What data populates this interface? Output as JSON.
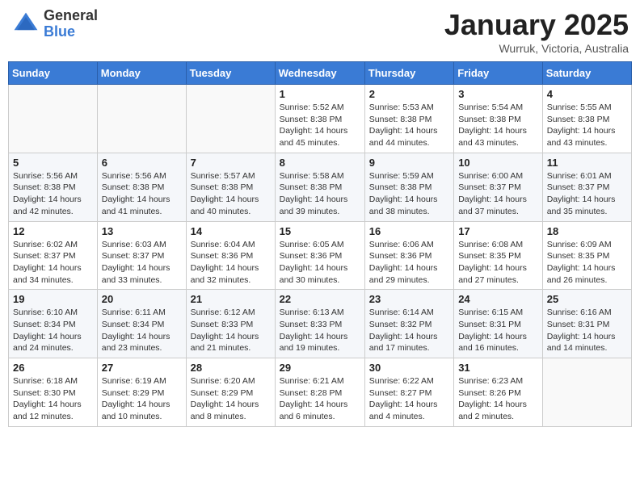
{
  "header": {
    "logo": {
      "general": "General",
      "blue": "Blue"
    },
    "title": "January 2025",
    "location": "Wurruk, Victoria, Australia"
  },
  "calendar": {
    "days_of_week": [
      "Sunday",
      "Monday",
      "Tuesday",
      "Wednesday",
      "Thursday",
      "Friday",
      "Saturday"
    ],
    "weeks": [
      [
        {
          "day": "",
          "info": ""
        },
        {
          "day": "",
          "info": ""
        },
        {
          "day": "",
          "info": ""
        },
        {
          "day": "1",
          "info": "Sunrise: 5:52 AM\nSunset: 8:38 PM\nDaylight: 14 hours\nand 45 minutes."
        },
        {
          "day": "2",
          "info": "Sunrise: 5:53 AM\nSunset: 8:38 PM\nDaylight: 14 hours\nand 44 minutes."
        },
        {
          "day": "3",
          "info": "Sunrise: 5:54 AM\nSunset: 8:38 PM\nDaylight: 14 hours\nand 43 minutes."
        },
        {
          "day": "4",
          "info": "Sunrise: 5:55 AM\nSunset: 8:38 PM\nDaylight: 14 hours\nand 43 minutes."
        }
      ],
      [
        {
          "day": "5",
          "info": "Sunrise: 5:56 AM\nSunset: 8:38 PM\nDaylight: 14 hours\nand 42 minutes."
        },
        {
          "day": "6",
          "info": "Sunrise: 5:56 AM\nSunset: 8:38 PM\nDaylight: 14 hours\nand 41 minutes."
        },
        {
          "day": "7",
          "info": "Sunrise: 5:57 AM\nSunset: 8:38 PM\nDaylight: 14 hours\nand 40 minutes."
        },
        {
          "day": "8",
          "info": "Sunrise: 5:58 AM\nSunset: 8:38 PM\nDaylight: 14 hours\nand 39 minutes."
        },
        {
          "day": "9",
          "info": "Sunrise: 5:59 AM\nSunset: 8:38 PM\nDaylight: 14 hours\nand 38 minutes."
        },
        {
          "day": "10",
          "info": "Sunrise: 6:00 AM\nSunset: 8:37 PM\nDaylight: 14 hours\nand 37 minutes."
        },
        {
          "day": "11",
          "info": "Sunrise: 6:01 AM\nSunset: 8:37 PM\nDaylight: 14 hours\nand 35 minutes."
        }
      ],
      [
        {
          "day": "12",
          "info": "Sunrise: 6:02 AM\nSunset: 8:37 PM\nDaylight: 14 hours\nand 34 minutes."
        },
        {
          "day": "13",
          "info": "Sunrise: 6:03 AM\nSunset: 8:37 PM\nDaylight: 14 hours\nand 33 minutes."
        },
        {
          "day": "14",
          "info": "Sunrise: 6:04 AM\nSunset: 8:36 PM\nDaylight: 14 hours\nand 32 minutes."
        },
        {
          "day": "15",
          "info": "Sunrise: 6:05 AM\nSunset: 8:36 PM\nDaylight: 14 hours\nand 30 minutes."
        },
        {
          "day": "16",
          "info": "Sunrise: 6:06 AM\nSunset: 8:36 PM\nDaylight: 14 hours\nand 29 minutes."
        },
        {
          "day": "17",
          "info": "Sunrise: 6:08 AM\nSunset: 8:35 PM\nDaylight: 14 hours\nand 27 minutes."
        },
        {
          "day": "18",
          "info": "Sunrise: 6:09 AM\nSunset: 8:35 PM\nDaylight: 14 hours\nand 26 minutes."
        }
      ],
      [
        {
          "day": "19",
          "info": "Sunrise: 6:10 AM\nSunset: 8:34 PM\nDaylight: 14 hours\nand 24 minutes."
        },
        {
          "day": "20",
          "info": "Sunrise: 6:11 AM\nSunset: 8:34 PM\nDaylight: 14 hours\nand 23 minutes."
        },
        {
          "day": "21",
          "info": "Sunrise: 6:12 AM\nSunset: 8:33 PM\nDaylight: 14 hours\nand 21 minutes."
        },
        {
          "day": "22",
          "info": "Sunrise: 6:13 AM\nSunset: 8:33 PM\nDaylight: 14 hours\nand 19 minutes."
        },
        {
          "day": "23",
          "info": "Sunrise: 6:14 AM\nSunset: 8:32 PM\nDaylight: 14 hours\nand 17 minutes."
        },
        {
          "day": "24",
          "info": "Sunrise: 6:15 AM\nSunset: 8:31 PM\nDaylight: 14 hours\nand 16 minutes."
        },
        {
          "day": "25",
          "info": "Sunrise: 6:16 AM\nSunset: 8:31 PM\nDaylight: 14 hours\nand 14 minutes."
        }
      ],
      [
        {
          "day": "26",
          "info": "Sunrise: 6:18 AM\nSunset: 8:30 PM\nDaylight: 14 hours\nand 12 minutes."
        },
        {
          "day": "27",
          "info": "Sunrise: 6:19 AM\nSunset: 8:29 PM\nDaylight: 14 hours\nand 10 minutes."
        },
        {
          "day": "28",
          "info": "Sunrise: 6:20 AM\nSunset: 8:29 PM\nDaylight: 14 hours\nand 8 minutes."
        },
        {
          "day": "29",
          "info": "Sunrise: 6:21 AM\nSunset: 8:28 PM\nDaylight: 14 hours\nand 6 minutes."
        },
        {
          "day": "30",
          "info": "Sunrise: 6:22 AM\nSunset: 8:27 PM\nDaylight: 14 hours\nand 4 minutes."
        },
        {
          "day": "31",
          "info": "Sunrise: 6:23 AM\nSunset: 8:26 PM\nDaylight: 14 hours\nand 2 minutes."
        },
        {
          "day": "",
          "info": ""
        }
      ]
    ]
  }
}
